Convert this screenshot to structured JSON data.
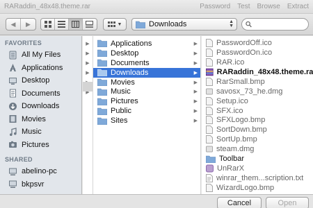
{
  "window": {
    "title": "RARaddin_48x48.theme.rar",
    "menu": [
      "Password",
      "Test",
      "Browse",
      "Extract"
    ]
  },
  "toolbar": {
    "back_icon": "chevron-left-icon",
    "forward_icon": "chevron-right-icon",
    "location": "Downloads",
    "search_placeholder": ""
  },
  "sidebar": {
    "favorites_heading": "FAVORITES",
    "favorites": [
      {
        "label": "All My Files",
        "icon": "all-files-icon"
      },
      {
        "label": "Applications",
        "icon": "applications-icon"
      },
      {
        "label": "Desktop",
        "icon": "desktop-icon"
      },
      {
        "label": "Documents",
        "icon": "documents-icon"
      },
      {
        "label": "Downloads",
        "icon": "downloads-icon"
      },
      {
        "label": "Movies",
        "icon": "movies-icon"
      },
      {
        "label": "Music",
        "icon": "music-icon"
      },
      {
        "label": "Pictures",
        "icon": "pictures-icon"
      }
    ],
    "shared_heading": "SHARED",
    "shared": [
      {
        "label": "abelino-pc",
        "icon": "computer-icon"
      },
      {
        "label": "bkpsvr",
        "icon": "computer-icon"
      }
    ]
  },
  "columns": {
    "folders": [
      "Applications",
      "Desktop",
      "Documents",
      "Downloads",
      "Movies",
      "Music",
      "Pictures",
      "Public",
      "Sites"
    ],
    "selected_folder": "Downloads",
    "files": [
      {
        "name": "PasswordOff.ico",
        "kind": "file"
      },
      {
        "name": "PasswordOn.ico",
        "kind": "file"
      },
      {
        "name": "RAR.ico",
        "kind": "file"
      },
      {
        "name": "RARaddin_48x48.theme.rar",
        "kind": "archive"
      },
      {
        "name": "RarSmall.bmp",
        "kind": "file"
      },
      {
        "name": "savosx_73_he.dmg",
        "kind": "file"
      },
      {
        "name": "Setup.ico",
        "kind": "file"
      },
      {
        "name": "SFX.ico",
        "kind": "file"
      },
      {
        "name": "SFXLogo.bmp",
        "kind": "file"
      },
      {
        "name": "SortDown.bmp",
        "kind": "file"
      },
      {
        "name": "SortUp.bmp",
        "kind": "file"
      },
      {
        "name": "steam.dmg",
        "kind": "file"
      },
      {
        "name": "Toolbar",
        "kind": "folder"
      },
      {
        "name": "UnRarX",
        "kind": "file"
      },
      {
        "name": "winrar_them...scription.txt",
        "kind": "file"
      },
      {
        "name": "WizardLogo.bmp",
        "kind": "file"
      }
    ]
  },
  "footer": {
    "cancel_label": "Cancel",
    "open_label": "Open"
  },
  "colors": {
    "selection": "#3874d8",
    "folder": "#7fa9d9",
    "sidebar_bg": "#e2e6eb"
  }
}
